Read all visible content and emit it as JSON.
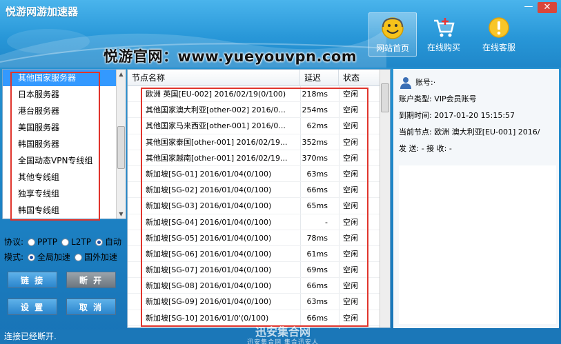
{
  "window": {
    "title": "悦游网游加速器",
    "min_label": "—",
    "close_label": "✕"
  },
  "watermark_text": "悦游官网：www.yueyouvpn.com",
  "nav": [
    {
      "label": "网站首页",
      "icon": "smiley-icon"
    },
    {
      "label": "在线购买",
      "icon": "cart-icon"
    },
    {
      "label": "在线客服",
      "icon": "alert-icon"
    }
  ],
  "server_groups": [
    "其他国家服务器",
    "日本服务器",
    "港台服务器",
    "美国服务器",
    "韩国服务器",
    "全国动态VPN专线组",
    "其他专线组",
    "独享专线组",
    "韩国专线组"
  ],
  "protocol": {
    "label": "协议:",
    "options": [
      "PPTP",
      "L2TP",
      "自动"
    ],
    "selected": "自动"
  },
  "mode": {
    "label": "模式:",
    "options": [
      "全局加速",
      "国外加速"
    ],
    "selected": "全局加速"
  },
  "buttons": {
    "connect": "链 接",
    "disconnect": "断 开",
    "settings": "设 置",
    "cancel": "取 消"
  },
  "table": {
    "headers": {
      "name": "节点名称",
      "latency": "延迟",
      "status": "状态"
    },
    "rows": [
      {
        "name": "欧洲 英国[EU-002] 2016/02/19(0/100)",
        "latency": "218ms",
        "status": "空闲"
      },
      {
        "name": "其他国家澳大利亚[other-002] 2016/0...",
        "latency": "254ms",
        "status": "空闲"
      },
      {
        "name": "其他国家马来西亚[other-001] 2016/0...",
        "latency": "62ms",
        "status": "空闲"
      },
      {
        "name": "其他国家泰国[other-001] 2016/02/19...",
        "latency": "352ms",
        "status": "空闲"
      },
      {
        "name": "其他国家越南[other-001] 2016/02/19...",
        "latency": "370ms",
        "status": "空闲"
      },
      {
        "name": "新加坡[SG-01] 2016/01/04(0/100)",
        "latency": "63ms",
        "status": "空闲"
      },
      {
        "name": "新加坡[SG-02] 2016/01/04(0/100)",
        "latency": "66ms",
        "status": "空闲"
      },
      {
        "name": "新加坡[SG-03] 2016/01/04(0/100)",
        "latency": "65ms",
        "status": "空闲"
      },
      {
        "name": "新加坡[SG-04] 2016/01/04(0/100)",
        "latency": "-",
        "status": "空闲"
      },
      {
        "name": "新加坡[SG-05] 2016/01/04(0/100)",
        "latency": "78ms",
        "status": "空闲"
      },
      {
        "name": "新加坡[SG-06] 2016/01/04(0/100)",
        "latency": "61ms",
        "status": "空闲"
      },
      {
        "name": "新加坡[SG-07] 2016/01/04(0/100)",
        "latency": "69ms",
        "status": "空闲"
      },
      {
        "name": "新加坡[SG-08] 2016/01/04(0/100)",
        "latency": "66ms",
        "status": "空闲"
      },
      {
        "name": "新加坡[SG-09] 2016/01/04(0/100)",
        "latency": "63ms",
        "status": "空闲"
      },
      {
        "name": "新加坡[SG-10] 2016/01/0'(0/100)",
        "latency": "66ms",
        "status": "空闲"
      }
    ]
  },
  "account": {
    "account": "账号:·",
    "type": "账户类型: VIP会员账号",
    "expiry": "到期时间: 2017-01-20 15:15:57",
    "node": "当前节点: 欧洲 澳大利亚[EU-001] 2016/",
    "traffic": "发 送: - 接 收: -"
  },
  "status_text": "连接已经断开.",
  "stamp": {
    "main": "迅安集合网",
    "sub": "迅安集合网 集合迅安人"
  },
  "colors": {
    "accent": "#2a98d6",
    "highlight": "#e0342c",
    "selected": "#3399ff"
  }
}
